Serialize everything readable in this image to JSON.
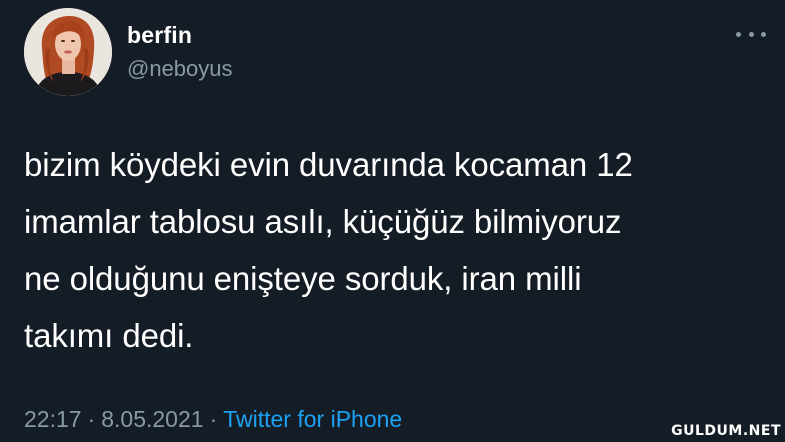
{
  "user": {
    "display_name": "berfin",
    "handle": "@neboyus",
    "avatar": "profile-photo"
  },
  "more_icon": "more-horizontal-icon",
  "tweet": {
    "text": "bizim köydeki evin duvarında kocaman 12\nimamlar tablosu asılı, küçüğüz bilmiyoruz\nne olduğunu enişteye sorduk, iran milli\ntakımı dedi."
  },
  "meta": {
    "time": "22:17",
    "separator": "·",
    "date": "8.05.2021",
    "source": "Twitter for iPhone"
  },
  "watermark": "GULDUM.NET",
  "colors": {
    "background": "#141d26",
    "primary_text": "#ffffff",
    "secondary_text": "#8899a6",
    "link": "#1da1f2"
  }
}
